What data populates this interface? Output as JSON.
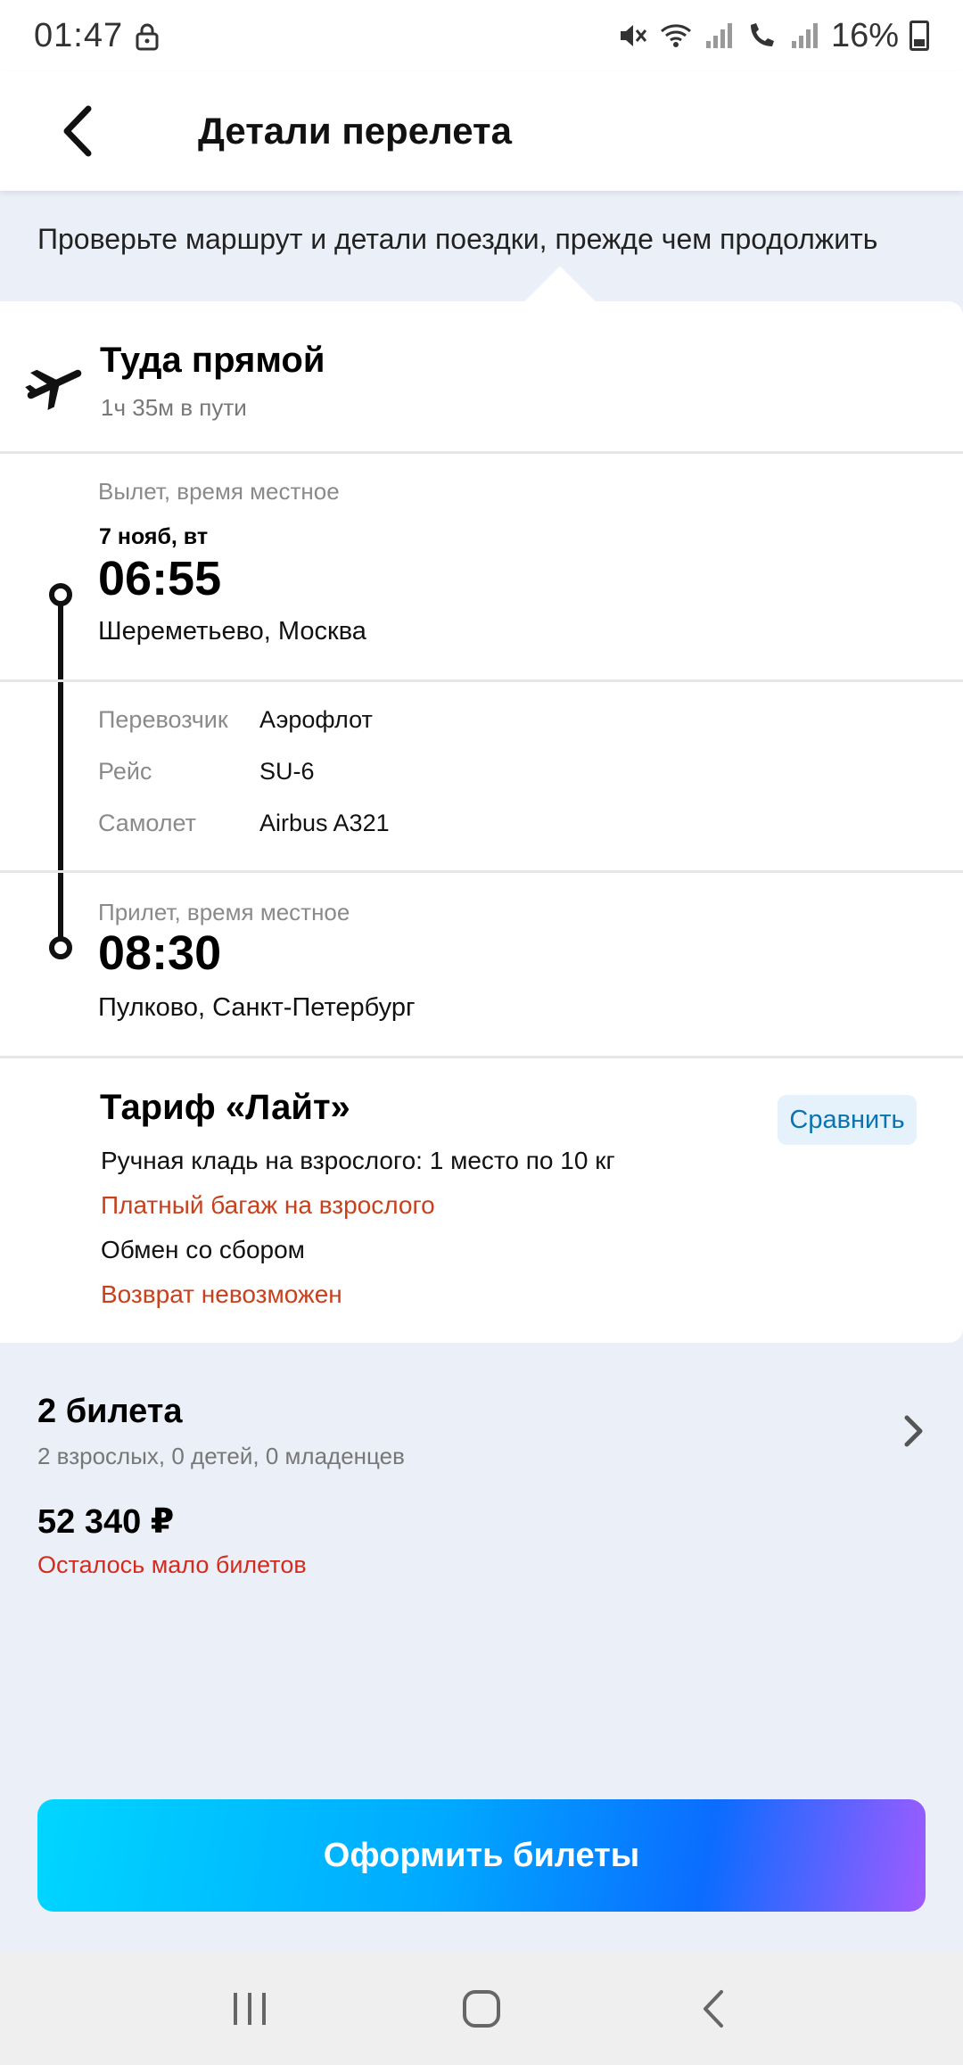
{
  "status_bar": {
    "time": "01:47",
    "battery": "16%"
  },
  "header": {
    "title": "Детали перелета"
  },
  "hint": "Проверьте маршрут и детали поездки, прежде чем продолжить",
  "route": {
    "title": "Туда прямой",
    "duration": "1ч 35м в пути",
    "departure": {
      "label": "Вылет, время местное",
      "date": "7 нояб, вт",
      "time": "06:55",
      "place": "Шереметьево, Москва"
    },
    "info": [
      {
        "key": "Перевозчик",
        "value": "Аэрофлот"
      },
      {
        "key": "Рейс",
        "value": "SU-6"
      },
      {
        "key": "Самолет",
        "value": "Airbus A321"
      }
    ],
    "arrival": {
      "label": "Прилет, время местное",
      "time": "08:30",
      "place": "Пулково, Санкт-Петербург"
    }
  },
  "tariff": {
    "title": "Тариф «Лайт»",
    "compare_label": "Сравнить",
    "lines": [
      {
        "text": "Ручная кладь на взрослого: 1 место по 10 кг",
        "color": "#111111"
      },
      {
        "text": "Платный багаж на взрослого",
        "color": "#c9401c"
      },
      {
        "text": "Обмен со сбором",
        "color": "#111111"
      },
      {
        "text": "Возврат невозможен",
        "color": "#c9401c"
      }
    ]
  },
  "tickets": {
    "title": "2 билета",
    "passengers": "2 взрослых, 0 детей, 0 младенцев",
    "price": "52 340 ₽",
    "availability": "Осталось мало билетов"
  },
  "cta_label": "Оформить билеты",
  "icons": {
    "back": "back-arrow-icon",
    "plane": "plane-icon",
    "chevron": "chevron-right-icon",
    "nav_recent": "recent-apps-icon",
    "nav_home": "home-icon",
    "nav_back": "nav-back-icon"
  }
}
